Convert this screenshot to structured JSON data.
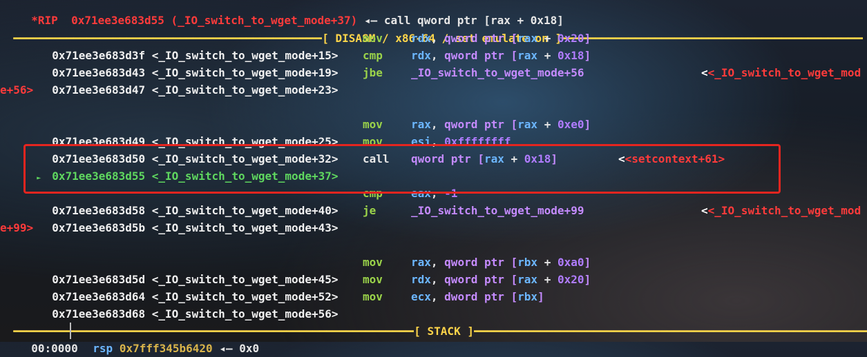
{
  "top_line": {
    "prefix": "*RIP  0x71ee3e683d55 (_IO_switch_to_wget_mode+37)",
    "arrow": " ◂— ",
    "instr": "call qword ptr [rax + 0x18]"
  },
  "disasm_header": {
    "dashes_left": "━━━━━━━━━━━━━━━━━━━━━━━━━━━━━━━━━━━━━━━━━━━━━━━━━━━━━━━━━━━━━━━━━━━━━━━━━━━━━━━━━━━━━━━━━━━━━━━━━━━━━━━━━━━━━━━━━━━━━━━━━━━━━━━━━━━━━━━━━━━━━━━━━━━━━━━━━━━━━━━━",
    "title": "[ DISASM / x86-64 / set emulate on ]",
    "dashes_right": "━━━━━━━━━━━━━━━━━━━━━━━━━━━━━━━━━━━━━━━━━━━━━━━━━━━━━━━━━━━━━━━━━━━━━━━━━━━━━━━━━━━━━━━━━━━━━━━━━━━━━━━━━━━━━━━━━━"
  },
  "instructions": [
    {
      "addr": "0x71ee3e683d3f",
      "sym": "<_IO_switch_to_wget_mode+15>",
      "mn": "mov",
      "o1": "rdx",
      "o2a": "qword ptr",
      "o2b": "rax",
      "o2c": "0x20"
    },
    {
      "addr": "0x71ee3e683d43",
      "sym": "<_IO_switch_to_wget_mode+19>",
      "mn": "cmp",
      "o1": "rdx",
      "o2a": "qword ptr",
      "o2b": "rax",
      "o2c": "0x18"
    },
    {
      "addr": "0x71ee3e683d47",
      "sym": "<_IO_switch_to_wget_mode+23>",
      "mn": "jbe",
      "target": "_IO_switch_to_wget_mode+56",
      "comment": "<_IO_switch_to_wget_mod",
      "comment_wrap": "e+56>"
    },
    {
      "addr": "0x71ee3e683d49",
      "sym": "<_IO_switch_to_wget_mode+25>",
      "mn": "mov",
      "o1": "rax",
      "o2a": "qword ptr",
      "o2b": "rax",
      "o2c": "0xe0"
    },
    {
      "addr": "0x71ee3e683d50",
      "sym": "<_IO_switch_to_wget_mode+32>",
      "mn": "mov",
      "o1": "esi",
      "o2": "0xffffffff"
    },
    {
      "marker": "►",
      "addr": "0x71ee3e683d55",
      "sym": "<_IO_switch_to_wget_mode+37>",
      "mn": "call",
      "o1a": "qword ptr",
      "o1b": "rax",
      "o1c": "0x18",
      "comment": "<setcontext+61>"
    },
    {
      "addr": "0x71ee3e683d58",
      "sym": "<_IO_switch_to_wget_mode+40>",
      "mn": "cmp",
      "o1": "eax",
      "o2": "-1"
    },
    {
      "addr": "0x71ee3e683d5b",
      "sym": "<_IO_switch_to_wget_mode+43>",
      "mn": "je",
      "target": "_IO_switch_to_wget_mode+99",
      "comment": "<_IO_switch_to_wget_mod",
      "comment_wrap": "e+99>"
    },
    {
      "addr": "0x71ee3e683d5d",
      "sym": "<_IO_switch_to_wget_mode+45>",
      "mn": "mov",
      "o1": "rax",
      "o2a": "qword ptr",
      "o2b": "rbx",
      "o2c": "0xa0"
    },
    {
      "addr": "0x71ee3e683d64",
      "sym": "<_IO_switch_to_wget_mode+52>",
      "mn": "mov",
      "o1": "rdx",
      "o2a": "qword ptr",
      "o2b": "rax",
      "o2c": "0x20"
    },
    {
      "addr": "0x71ee3e683d68",
      "sym": "<_IO_switch_to_wget_mode+56>",
      "mn": "mov",
      "o1": "ecx",
      "o2a": "dword ptr",
      "o2b": "rbx"
    }
  ],
  "stack_header": {
    "dashes_left": "━━━━━━━━━━━━━━━━━━━━━━━━━━━━━━━━━━━━━━━━━━━━━━━━━━━━━━━━━━━━━━━━━━━━━━━━━━━━━━━━━━━━━━━━━━━━━━━━━━━━━━━━━━━━━━━━━━━━━━━━━━━━━━━━━━━━━━━━━━━━━━━━━━━━━━━━━━━━",
    "title": "[ STACK ]",
    "dashes_right": "━━━━━━━━━━━━━━━━━━━━━━━━━━━━━━━━━━━━━━━━━━━━━━━━━━━━━━━━━━━━━━━━━━━━━━━━━━━━━━━━━━━━━━━━━━━━━━━━━━━━━━━━━━━━━━━━━"
  },
  "stack": {
    "offset": "00:0000",
    "reg": "rsp",
    "addr": "0x7fff345b6420",
    "arrow": " ◂— ",
    "val": "0x0"
  }
}
